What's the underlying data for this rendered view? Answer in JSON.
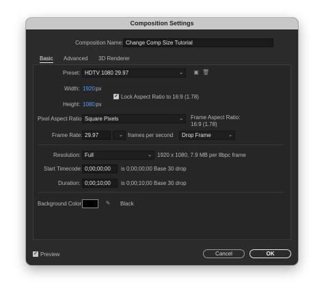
{
  "window": {
    "title": "Composition Settings"
  },
  "comp_name": {
    "label": "Composition Name:",
    "value": "Change Comp Size Tutorial"
  },
  "tabs": [
    {
      "label": "Basic",
      "active": true
    },
    {
      "label": "Advanced",
      "active": false
    },
    {
      "label": "3D Renderer",
      "active": false
    }
  ],
  "preset": {
    "label": "Preset:",
    "value": "HDTV 1080 29.97",
    "save_icon": "save-icon",
    "delete_icon": "trash-icon"
  },
  "width": {
    "label": "Width:",
    "value": "1920",
    "unit": "px"
  },
  "height": {
    "label": "Height:",
    "value": "1080",
    "unit": "px"
  },
  "lock_aspect": {
    "label": "Lock Aspect Ratio to 16:9 (1.78)",
    "checked": true
  },
  "pixel_aspect": {
    "label": "Pixel Aspect Ratio:",
    "value": "Square Pixels",
    "frame_aspect_label": "Frame Aspect Ratio:",
    "frame_aspect_value": "16:9 (1.78)"
  },
  "frame_rate": {
    "label": "Frame Rate:",
    "value": "29.97",
    "unit": "frames per second",
    "drop_value": "Drop Frame"
  },
  "resolution": {
    "label": "Resolution:",
    "value": "Full",
    "info": "1920 x 1080, 7.9 MB per 8bpc frame"
  },
  "start_timecode": {
    "label": "Start Timecode:",
    "value": "0;00;00;00",
    "info": "is 0;00;00;00  Base 30  drop"
  },
  "duration": {
    "label": "Duration:",
    "value": "0;00;10;00",
    "info": "is 0;00;10;00  Base 30  drop"
  },
  "background": {
    "label": "Background Color:",
    "color": "#000000",
    "name": "Black",
    "eyedropper_icon": "eyedropper-icon"
  },
  "footer": {
    "preview_label": "Preview",
    "preview_checked": true,
    "cancel": "Cancel",
    "ok": "OK"
  }
}
